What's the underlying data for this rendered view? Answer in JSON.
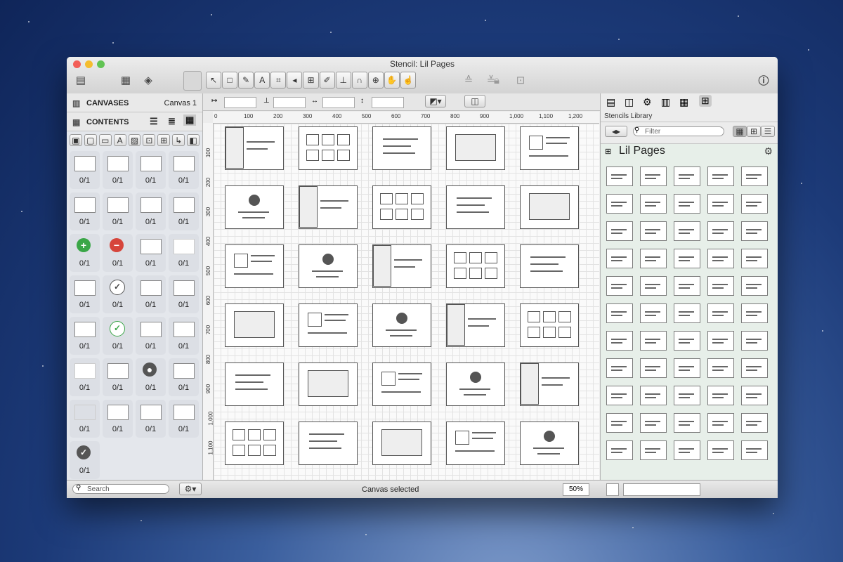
{
  "window": {
    "title": "Stencil: Lil Pages"
  },
  "left_panel": {
    "canvases_label": "CANVASES",
    "canvas_selector": "Canvas 1",
    "contents_label": "CONTENTS",
    "items": [
      "0/1",
      "0/1",
      "0/1",
      "0/1",
      "0/1",
      "0/1",
      "0/1",
      "0/1",
      "0/1",
      "0/1",
      "0/1",
      "0/1",
      "0/1",
      "0/1",
      "0/1",
      "0/1",
      "0/1",
      "0/1",
      "0/1",
      "0/1",
      "0/1",
      "0/1",
      "0/1",
      "0/1",
      "0/1",
      "0/1",
      "0/1",
      "0/1",
      "0/1"
    ],
    "search_placeholder": "Search"
  },
  "ruler": {
    "top_ticks": [
      "0",
      "100",
      "200",
      "300",
      "400",
      "500",
      "600",
      "700",
      "800",
      "900",
      "1,000",
      "1,100",
      "1,200"
    ],
    "left_ticks": [
      "100",
      "200",
      "300",
      "400",
      "500",
      "600",
      "700",
      "800",
      "900",
      "1,000",
      "1,100"
    ]
  },
  "status": {
    "text": "Canvas selected",
    "zoom": "50%"
  },
  "right_panel": {
    "library_label": "Stencils Library",
    "filter_placeholder": "Filter",
    "section_title": "Lil Pages"
  }
}
